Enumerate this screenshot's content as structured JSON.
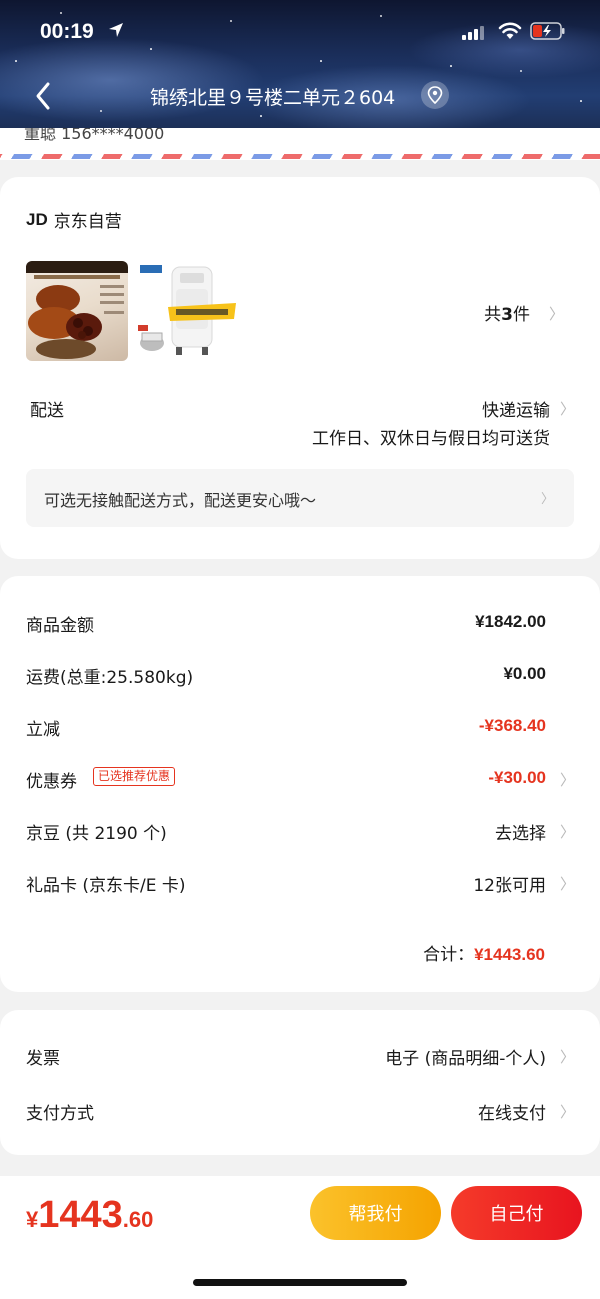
{
  "status_bar": {
    "time": "00:19"
  },
  "nav": {
    "title": "锦绣北里９号楼二单元２604"
  },
  "address_strip": {
    "partial_text": "重聪 156****4000"
  },
  "order": {
    "shop_logo": "JD",
    "shop_name": "京东自营",
    "product_count_prefix": "共",
    "product_count": "3",
    "product_count_suffix": "件",
    "delivery_label": "配送",
    "delivery_method": "快递运输",
    "delivery_time": "工作日、双休日与假日均可送货",
    "contactless_notice": "可选无接触配送方式，配送更安心哦～"
  },
  "summary": {
    "rows": [
      {
        "label": "商品金额",
        "value": "¥1842.00"
      },
      {
        "label": "运费(总重:25.580kg)",
        "value": "¥0.00"
      },
      {
        "label": "立减",
        "value": "-¥368.40"
      },
      {
        "label": "优惠券",
        "value": "-¥30.00",
        "tag": "已选推荐优惠"
      },
      {
        "label": "京豆 (共 2190 个)",
        "value": "去选择"
      },
      {
        "label": "礼品卡 (京东卡/E 卡)",
        "value": "12张可用"
      }
    ],
    "total_label": "合计：",
    "total_value": "¥1443.60"
  },
  "invoice": {
    "invoice_label": "发票",
    "invoice_value": "电子 (商品明细-个人)",
    "payment_label": "支付方式",
    "payment_value": "在线支付"
  },
  "bottom": {
    "currency": "¥",
    "price_int": "1443",
    "price_dec": ".60",
    "help_pay": "帮我付",
    "self_pay": "自己付"
  },
  "colors": {
    "accent_red": "#e5341f",
    "help_yellow": "#f5a300",
    "self_red": "#e8141f"
  }
}
